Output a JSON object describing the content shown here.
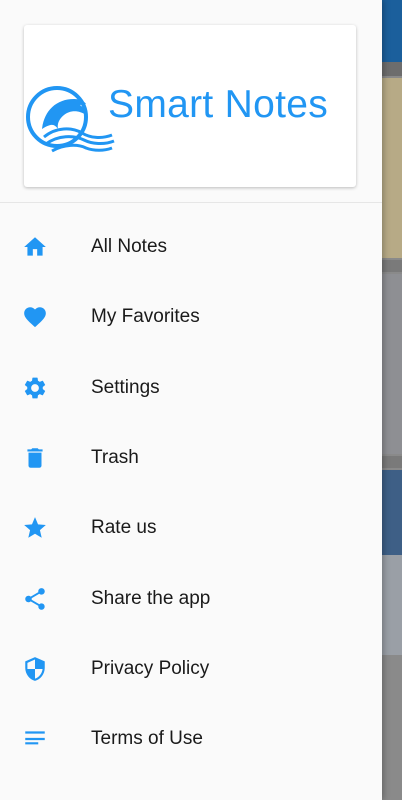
{
  "colors": {
    "accent": "#2196f3"
  },
  "header": {
    "title": "Smart Notes",
    "logo_icon": "dolphin-wave-logo"
  },
  "menu": {
    "items": [
      {
        "label": "All Notes",
        "icon": "home-icon"
      },
      {
        "label": "My Favorites",
        "icon": "heart-icon"
      },
      {
        "label": "Settings",
        "icon": "gear-icon"
      },
      {
        "label": "Trash",
        "icon": "trash-icon"
      },
      {
        "label": "Rate us",
        "icon": "star-icon"
      },
      {
        "label": "Share the app",
        "icon": "share-icon"
      },
      {
        "label": "Privacy Policy",
        "icon": "shield-icon"
      },
      {
        "label": "Terms of Use",
        "icon": "lines-icon"
      }
    ]
  }
}
